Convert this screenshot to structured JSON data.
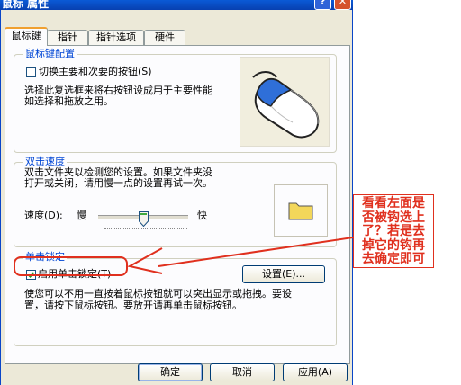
{
  "window": {
    "title": "鼠标 属性",
    "help_label": "?",
    "close_label": "✕"
  },
  "tabs": [
    {
      "label": "鼠标键",
      "active": true
    },
    {
      "label": "指针",
      "active": false
    },
    {
      "label": "指针选项",
      "active": false
    },
    {
      "label": "硬件",
      "active": false
    }
  ],
  "buttons_group": {
    "title": "鼠标键配置",
    "checkbox_label": "切换主要和次要的按钮(S)",
    "checked": false,
    "description_1": "选择此复选框来将右按钮设成用于主要性能",
    "description_2": "如选择和拖放之用。"
  },
  "double_click": {
    "title": "双击速度",
    "description_1": "双击文件夹以检测您的设置。如果文件夹没",
    "description_2": "打开或关闭，请用慢一点的设置再试一次。",
    "speed_label": "速度(D):",
    "slow_label": "慢",
    "fast_label": "快",
    "slider_value_fraction": 0.5
  },
  "click_lock": {
    "title": "单击锁定",
    "checkbox_label": "启用单击锁定(T)",
    "checked": true,
    "settings_button": "设置(E)...",
    "description_1": "使您可以不用一直按着鼠标按钮就可以突出显示或拖拽。要设",
    "description_2": "置，请按下鼠标按钮。要放开请再单击鼠标按钮。"
  },
  "footer": {
    "ok": "确定",
    "cancel": "取消",
    "apply": "应用(A)"
  },
  "annotation": {
    "text": "看看左面是否被钩选上了？若是去掉它的钩再去确定即可",
    "color": "#e0301e"
  },
  "colors": {
    "accent": "#0046d5",
    "titlebar": "#0a5ad6",
    "dialog_bg": "#ece9d8"
  }
}
